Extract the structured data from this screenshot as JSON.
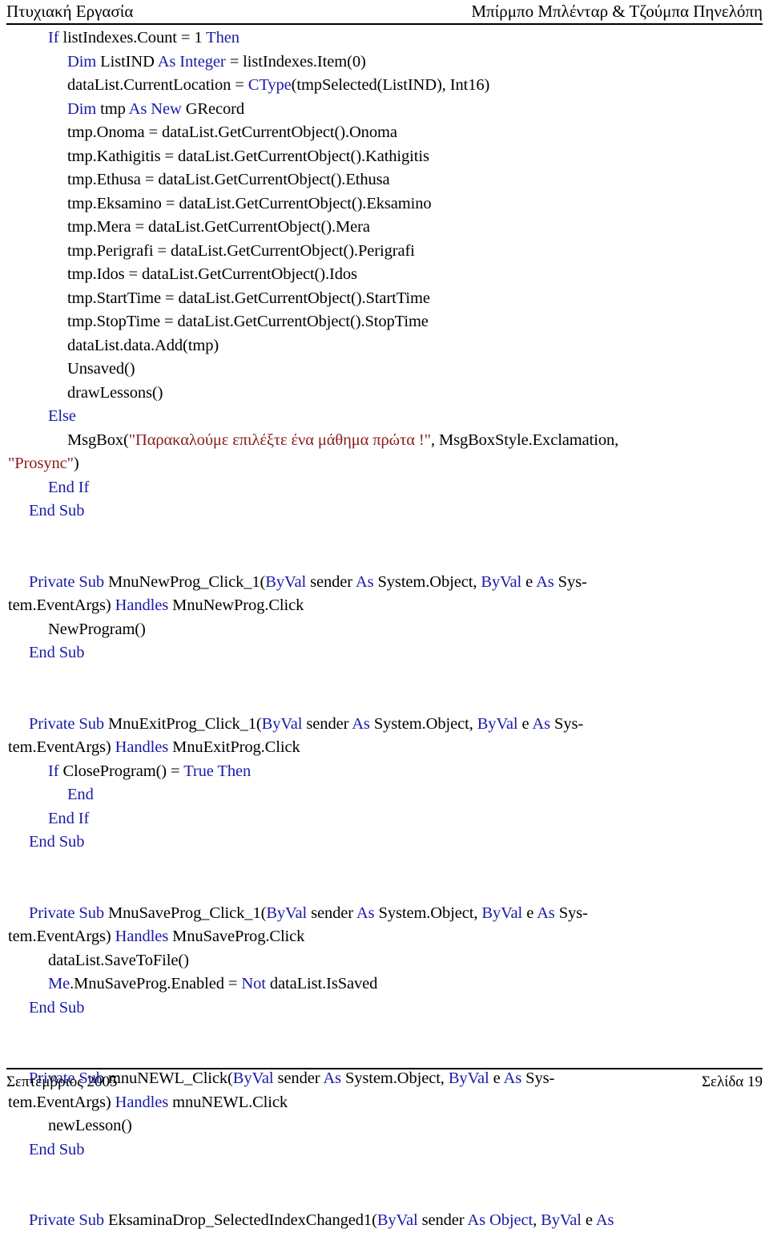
{
  "header": {
    "left": "Πτυχιακή Εργασία",
    "right": "Μπίρμπο Μπλένταρ & Τζούμπα Πηνελόπη"
  },
  "footer": {
    "left": "Σεπτέμβριος 2005",
    "right": "Σελίδα 19"
  },
  "colors": {
    "keyword": "#1a1aa8",
    "string": "#8b1a1a",
    "identifier": "#000000",
    "rule": "#000000",
    "background": "#ffffff"
  },
  "code": {
    "language": "Visual Basic .NET",
    "lines": [
      {
        "indent": 50,
        "spans": [
          {
            "t": "If ",
            "c": "kw"
          },
          {
            "t": "listIndexes.Count = 1 ",
            "c": "id"
          },
          {
            "t": "Then",
            "c": "kw"
          }
        ]
      },
      {
        "indent": 74,
        "spans": [
          {
            "t": "Dim ",
            "c": "kw"
          },
          {
            "t": "ListIND ",
            "c": "id"
          },
          {
            "t": "As Integer",
            "c": "kw"
          },
          {
            "t": " = listIndexes.Item(0)",
            "c": "id"
          }
        ]
      },
      {
        "indent": 74,
        "spans": [
          {
            "t": "dataList.CurrentLocation = ",
            "c": "id"
          },
          {
            "t": "CType",
            "c": "kw"
          },
          {
            "t": "(tmpSelected(ListIND), Int16)",
            "c": "id"
          }
        ]
      },
      {
        "indent": 74,
        "spans": [
          {
            "t": "Dim ",
            "c": "kw"
          },
          {
            "t": "tmp ",
            "c": "id"
          },
          {
            "t": "As New ",
            "c": "kw"
          },
          {
            "t": "GRecord",
            "c": "id"
          }
        ]
      },
      {
        "indent": 74,
        "spans": [
          {
            "t": "tmp.Onoma = dataList.GetCurrentObject().Onoma",
            "c": "id"
          }
        ]
      },
      {
        "indent": 74,
        "spans": [
          {
            "t": "tmp.Kathigitis = dataList.GetCurrentObject().Kathigitis",
            "c": "id"
          }
        ]
      },
      {
        "indent": 74,
        "spans": [
          {
            "t": "tmp.Ethusa = dataList.GetCurrentObject().Ethusa",
            "c": "id"
          }
        ]
      },
      {
        "indent": 74,
        "spans": [
          {
            "t": "tmp.Eksamino = dataList.GetCurrentObject().Eksamino",
            "c": "id"
          }
        ]
      },
      {
        "indent": 74,
        "spans": [
          {
            "t": "tmp.Mera = dataList.GetCurrentObject().Mera",
            "c": "id"
          }
        ]
      },
      {
        "indent": 74,
        "spans": [
          {
            "t": "tmp.Perigrafi = dataList.GetCurrentObject().Perigrafi",
            "c": "id"
          }
        ]
      },
      {
        "indent": 74,
        "spans": [
          {
            "t": "tmp.Idos = dataList.GetCurrentObject().Idos",
            "c": "id"
          }
        ]
      },
      {
        "indent": 74,
        "spans": [
          {
            "t": "tmp.StartTime = dataList.GetCurrentObject().StartTime",
            "c": "id"
          }
        ]
      },
      {
        "indent": 74,
        "spans": [
          {
            "t": "tmp.StopTime = dataList.GetCurrentObject().StopTime",
            "c": "id"
          }
        ]
      },
      {
        "indent": 74,
        "spans": [
          {
            "t": "dataList.data.Add(tmp)",
            "c": "id"
          }
        ]
      },
      {
        "indent": 74,
        "spans": [
          {
            "t": "Unsaved()",
            "c": "id"
          }
        ]
      },
      {
        "indent": 74,
        "spans": [
          {
            "t": "drawLessons()",
            "c": "id"
          }
        ]
      },
      {
        "indent": 50,
        "spans": [
          {
            "t": "Else",
            "c": "kw"
          }
        ]
      },
      {
        "indent": 74,
        "spans": [
          {
            "t": "MsgBox(",
            "c": "id"
          },
          {
            "t": "\"Παρακαλούμε επιλέξτε ένα μάθημα πρώτα !\"",
            "c": "str"
          },
          {
            "t": ", MsgBoxStyle.Exclamation,",
            "c": "id"
          }
        ]
      },
      {
        "indent": 0,
        "spans": [
          {
            "t": "\"Prosync\"",
            "c": "str"
          },
          {
            "t": ")",
            "c": "id"
          }
        ]
      },
      {
        "indent": 50,
        "spans": [
          {
            "t": "End If",
            "c": "kw"
          }
        ]
      },
      {
        "indent": 26,
        "spans": [
          {
            "t": "End Sub",
            "c": "kw"
          }
        ]
      },
      {
        "indent": 0,
        "spans": []
      },
      {
        "indent": 0,
        "spans": []
      },
      {
        "indent": 26,
        "spans": [
          {
            "t": "Private Sub ",
            "c": "kw"
          },
          {
            "t": "MnuNewProg_Click_1(",
            "c": "id"
          },
          {
            "t": "ByVal ",
            "c": "kw"
          },
          {
            "t": "sender ",
            "c": "id"
          },
          {
            "t": "As ",
            "c": "kw"
          },
          {
            "t": "System.Object, ",
            "c": "id"
          },
          {
            "t": "ByVal ",
            "c": "kw"
          },
          {
            "t": "e ",
            "c": "id"
          },
          {
            "t": "As ",
            "c": "kw"
          },
          {
            "t": "Sys-",
            "c": "id"
          }
        ]
      },
      {
        "indent": 0,
        "spans": [
          {
            "t": "tem.EventArgs) ",
            "c": "id"
          },
          {
            "t": "Handles ",
            "c": "kw"
          },
          {
            "t": "MnuNewProg.Click",
            "c": "id"
          }
        ]
      },
      {
        "indent": 50,
        "spans": [
          {
            "t": "NewProgram()",
            "c": "id"
          }
        ]
      },
      {
        "indent": 26,
        "spans": [
          {
            "t": "End Sub",
            "c": "kw"
          }
        ]
      },
      {
        "indent": 0,
        "spans": []
      },
      {
        "indent": 0,
        "spans": []
      },
      {
        "indent": 26,
        "spans": [
          {
            "t": "Private Sub ",
            "c": "kw"
          },
          {
            "t": "MnuExitProg_Click_1(",
            "c": "id"
          },
          {
            "t": "ByVal ",
            "c": "kw"
          },
          {
            "t": "sender ",
            "c": "id"
          },
          {
            "t": "As ",
            "c": "kw"
          },
          {
            "t": "System.Object, ",
            "c": "id"
          },
          {
            "t": "ByVal ",
            "c": "kw"
          },
          {
            "t": "e ",
            "c": "id"
          },
          {
            "t": "As ",
            "c": "kw"
          },
          {
            "t": "Sys-",
            "c": "id"
          }
        ]
      },
      {
        "indent": 0,
        "spans": [
          {
            "t": "tem.EventArgs) ",
            "c": "id"
          },
          {
            "t": "Handles ",
            "c": "kw"
          },
          {
            "t": "MnuExitProg.Click",
            "c": "id"
          }
        ]
      },
      {
        "indent": 50,
        "spans": [
          {
            "t": "If ",
            "c": "kw"
          },
          {
            "t": "CloseProgram() = ",
            "c": "id"
          },
          {
            "t": "True Then",
            "c": "kw"
          }
        ]
      },
      {
        "indent": 74,
        "spans": [
          {
            "t": "End",
            "c": "kw"
          }
        ]
      },
      {
        "indent": 50,
        "spans": [
          {
            "t": "End If",
            "c": "kw"
          }
        ]
      },
      {
        "indent": 26,
        "spans": [
          {
            "t": "End Sub",
            "c": "kw"
          }
        ]
      },
      {
        "indent": 0,
        "spans": []
      },
      {
        "indent": 0,
        "spans": []
      },
      {
        "indent": 26,
        "spans": [
          {
            "t": "Private Sub ",
            "c": "kw"
          },
          {
            "t": "MnuSaveProg_Click_1(",
            "c": "id"
          },
          {
            "t": "ByVal ",
            "c": "kw"
          },
          {
            "t": "sender ",
            "c": "id"
          },
          {
            "t": "As ",
            "c": "kw"
          },
          {
            "t": "System.Object, ",
            "c": "id"
          },
          {
            "t": "ByVal ",
            "c": "kw"
          },
          {
            "t": "e ",
            "c": "id"
          },
          {
            "t": "As ",
            "c": "kw"
          },
          {
            "t": "Sys-",
            "c": "id"
          }
        ]
      },
      {
        "indent": 0,
        "spans": [
          {
            "t": "tem.EventArgs) ",
            "c": "id"
          },
          {
            "t": "Handles ",
            "c": "kw"
          },
          {
            "t": "MnuSaveProg.Click",
            "c": "id"
          }
        ]
      },
      {
        "indent": 50,
        "spans": [
          {
            "t": "dataList.SaveToFile()",
            "c": "id"
          }
        ]
      },
      {
        "indent": 50,
        "spans": [
          {
            "t": "Me",
            "c": "kw"
          },
          {
            "t": ".MnuSaveProg.Enabled = ",
            "c": "id"
          },
          {
            "t": "Not ",
            "c": "kw"
          },
          {
            "t": "dataList.IsSaved",
            "c": "id"
          }
        ]
      },
      {
        "indent": 26,
        "spans": [
          {
            "t": "End Sub",
            "c": "kw"
          }
        ]
      },
      {
        "indent": 0,
        "spans": []
      },
      {
        "indent": 0,
        "spans": []
      },
      {
        "indent": 26,
        "spans": [
          {
            "t": "Private Sub ",
            "c": "kw"
          },
          {
            "t": "mnuNEWL_Click(",
            "c": "id"
          },
          {
            "t": "ByVal ",
            "c": "kw"
          },
          {
            "t": "sender ",
            "c": "id"
          },
          {
            "t": "As ",
            "c": "kw"
          },
          {
            "t": "System.Object, ",
            "c": "id"
          },
          {
            "t": "ByVal ",
            "c": "kw"
          },
          {
            "t": "e ",
            "c": "id"
          },
          {
            "t": "As ",
            "c": "kw"
          },
          {
            "t": "Sys-",
            "c": "id"
          }
        ]
      },
      {
        "indent": 0,
        "spans": [
          {
            "t": "tem.EventArgs) ",
            "c": "id"
          },
          {
            "t": "Handles ",
            "c": "kw"
          },
          {
            "t": "mnuNEWL.Click",
            "c": "id"
          }
        ]
      },
      {
        "indent": 50,
        "spans": [
          {
            "t": "newLesson()",
            "c": "id"
          }
        ]
      },
      {
        "indent": 26,
        "spans": [
          {
            "t": "End Sub",
            "c": "kw"
          }
        ]
      },
      {
        "indent": 0,
        "spans": []
      },
      {
        "indent": 0,
        "spans": []
      },
      {
        "indent": 26,
        "spans": [
          {
            "t": "Private Sub ",
            "c": "kw"
          },
          {
            "t": "EksaminaDrop_SelectedIndexChanged1(",
            "c": "id"
          },
          {
            "t": "ByVal ",
            "c": "kw"
          },
          {
            "t": "sender ",
            "c": "id"
          },
          {
            "t": "As Object",
            "c": "kw"
          },
          {
            "t": ", ",
            "c": "id"
          },
          {
            "t": "ByVal ",
            "c": "kw"
          },
          {
            "t": "e ",
            "c": "id"
          },
          {
            "t": "As",
            "c": "kw"
          }
        ]
      }
    ]
  }
}
